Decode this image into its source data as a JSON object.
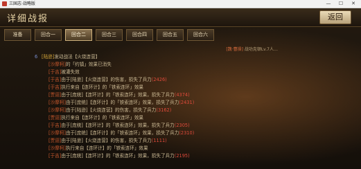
{
  "window": {
    "title": "三国志·战略版",
    "buttons": [
      "—",
      "☐",
      "✕"
    ]
  },
  "header": {
    "title": "详细战报",
    "back_label": "返回"
  },
  "tabs": [
    {
      "label": "准备",
      "active": false
    },
    {
      "label": "回合一",
      "active": false
    },
    {
      "label": "回合二",
      "active": true
    },
    {
      "label": "回合三",
      "active": false
    },
    {
      "label": "回合四",
      "active": false
    },
    {
      "label": "回合五",
      "active": false
    },
    {
      "label": "回合六",
      "active": false
    }
  ],
  "top_note": {
    "tag": "[魏·曹操]",
    "text": "战功克顿Lv.7人…"
  },
  "log": [
    {
      "idx": "6",
      "who": "[陆逊]",
      "who_color": "y",
      "text": "发动战法【火烧连营】"
    },
    {
      "who": "[沙摩柯]",
      "who_color": "r",
      "text": "的「约镇」效果已消失"
    },
    {
      "who": "[于吉]",
      "who_color": "r",
      "text": "被灌失效"
    },
    {
      "who": "[于吉]",
      "who_color": "r",
      "text": "由于[陆逊]【火烧连营】的伤害，损失了兵力",
      "num": "(2426)"
    },
    {
      "who": "[于吉]",
      "who_color": "r",
      "text": "执行来自【连环计】的「铁索连环」效果"
    },
    {
      "who": "[贾诩]",
      "who_color": "r",
      "text": "由于[庞统]【连环计】的「铁索连环」效果，损失了兵力",
      "num": "(4374)"
    },
    {
      "who": "[沙摩柯]",
      "who_color": "r",
      "text": "由于[庞统]【连环计】的「铁索连环」效果，损失了兵力",
      "num": "(2431)"
    },
    {
      "who": "[沙摩柯]",
      "who_color": "r",
      "text": "由于[陆逊]【火烧连营】的伤害，损失了兵力",
      "num": "(3162)"
    },
    {
      "who": "[贾诩]",
      "who_color": "r",
      "text": "执行来自【连环计】的「铁索连环」效果"
    },
    {
      "who": "[于吉]",
      "who_color": "r",
      "text": "由于[庞统]【连环计】的「铁索连环」效果，损失了兵力",
      "num": "(2305)"
    },
    {
      "who": "[沙摩柯]",
      "who_color": "r",
      "text": "由于[庞统]【连环计】的「铁索连环」效果，损失了兵力",
      "num": "(2310)"
    },
    {
      "who": "[贾诩]",
      "who_color": "r",
      "text": "由于[陆逊]【火烧连营】的伤害，损失了兵力",
      "num": "(1111)"
    },
    {
      "who": "[沙摩柯]",
      "who_color": "r",
      "text": "执行来自【连环计】的「铁索连环」效果"
    },
    {
      "who": "[于吉]",
      "who_color": "r",
      "text": "由于[庞统]【连环计】的「铁索连环」效果，损失了兵力",
      "num": "(2195)"
    }
  ]
}
